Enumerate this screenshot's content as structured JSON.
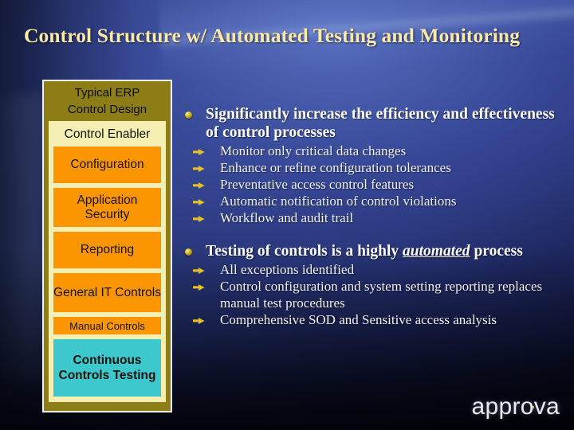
{
  "slide": {
    "title": "Control Structure w/ Automated Testing and Monitoring",
    "background_color": "#22305e",
    "title_color": "#fbe9a8"
  },
  "diagram": {
    "panel_title_line1": "Typical ERP",
    "panel_title_line2": "Control Design",
    "section_label": "Control Enabler",
    "panel_border_color": "#f2f2ea",
    "panel_fill_color": "#8c7d16",
    "inner_fill_color": "#f5efb4",
    "node_color": "#fb9600",
    "highlight_color": "#3cc8cd",
    "nodes": [
      {
        "label": "Configuration",
        "style": "orange",
        "size": "tall"
      },
      {
        "label": "Application Security",
        "style": "orange",
        "size": "tall2"
      },
      {
        "label": "Reporting",
        "style": "orange",
        "size": "tall"
      },
      {
        "label": "General IT Controls",
        "style": "orange",
        "size": "tall2"
      },
      {
        "label": "Manual Controls",
        "style": "orange",
        "size": "slim"
      },
      {
        "label": "Continuous Controls Testing",
        "style": "cyan",
        "size": "triple"
      }
    ]
  },
  "content": {
    "blocks": [
      {
        "heading_pre": "Significantly increase the efficiency and effectiveness of control processes",
        "heading_emphasis": "",
        "heading_post": "",
        "items": [
          "Monitor only critical data changes",
          "Enhance or refine configuration tolerances",
          "Preventative access control features",
          "Automatic notification of control violations",
          "Workflow and audit trail"
        ]
      },
      {
        "heading_pre": "Testing of controls is a highly ",
        "heading_emphasis": "automated",
        "heading_post": " process",
        "items": [
          "All exceptions identified",
          "Control configuration and system setting reporting replaces manual test procedures",
          "Comprehensive SOD and Sensitive access analysis"
        ]
      }
    ],
    "bullet_color": "#d8c024",
    "arrow_color": "#e8c21c",
    "text_color": "#ffffff"
  },
  "branding": {
    "logo_text": "approva",
    "logo_color": "#e8eaee",
    "logo_accent_color": "#cdd73a"
  }
}
